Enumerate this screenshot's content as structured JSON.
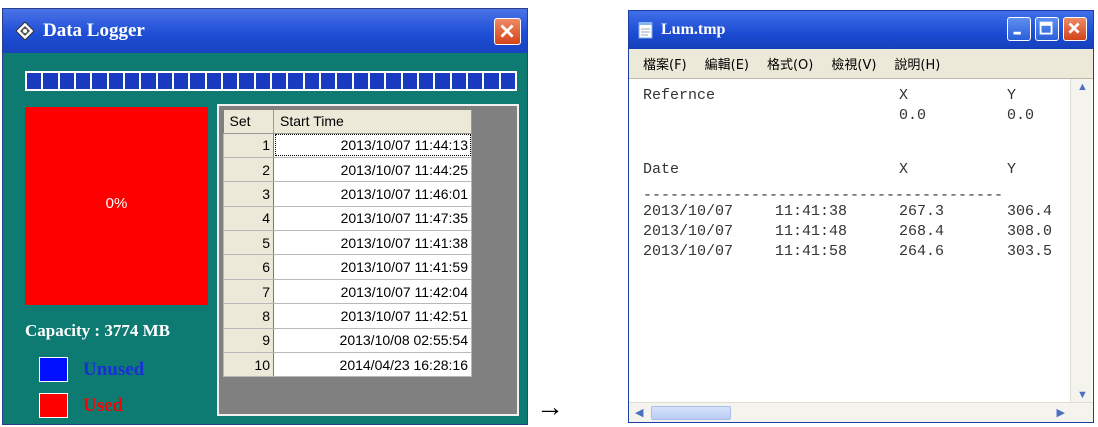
{
  "data_logger": {
    "title": "Data Logger",
    "progress_segments": 30,
    "used_percent_label": "0%",
    "capacity_text": "Capacity : 3774 MB",
    "legend": [
      {
        "label": "Unused",
        "color": "#0010ff"
      },
      {
        "label": "Used",
        "color": "#ff0000"
      }
    ],
    "table": {
      "headers": [
        "Set",
        "Start Time"
      ],
      "rows": [
        {
          "set": "1",
          "start_time": "2013/10/07 11:44:13"
        },
        {
          "set": "2",
          "start_time": "2013/10/07 11:44:25"
        },
        {
          "set": "3",
          "start_time": "2013/10/07 11:46:01"
        },
        {
          "set": "4",
          "start_time": "2013/10/07 11:47:35"
        },
        {
          "set": "5",
          "start_time": "2013/10/07 11:41:38"
        },
        {
          "set": "6",
          "start_time": "2013/10/07 11:41:59"
        },
        {
          "set": "7",
          "start_time": "2013/10/07 11:42:04"
        },
        {
          "set": "8",
          "start_time": "2013/10/07 11:42:51"
        },
        {
          "set": "9",
          "start_time": "2013/10/08 02:55:54"
        },
        {
          "set": "10",
          "start_time": "2014/04/23 16:28:16"
        }
      ]
    }
  },
  "arrow": "→",
  "notepad": {
    "title": "Lum.tmp",
    "menu": [
      "檔案(F)",
      "編輯(E)",
      "格式(O)",
      "檢視(V)",
      "說明(H)"
    ],
    "reference": {
      "label": "Refernce",
      "x_header": "X",
      "y_header": "Y",
      "x": "0.0",
      "y": "0.0"
    },
    "data_header": {
      "date": "Date",
      "x": "X",
      "y": "Y"
    },
    "separator": "----------------------------------------",
    "rows": [
      {
        "date": "2013/10/07",
        "time": "11:41:38",
        "x": "267.3",
        "y": "306.4"
      },
      {
        "date": "2013/10/07",
        "time": "11:41:48",
        "x": "268.4",
        "y": "308.0"
      },
      {
        "date": "2013/10/07",
        "time": "11:41:58",
        "x": "264.6",
        "y": "303.5"
      }
    ]
  },
  "colors": {
    "titlebar_blue": "#1f4fd6",
    "window_teal": "#0d7b72",
    "used_red": "#ff0000",
    "unused_blue": "#0010ff",
    "close_orange": "#d3431a"
  }
}
